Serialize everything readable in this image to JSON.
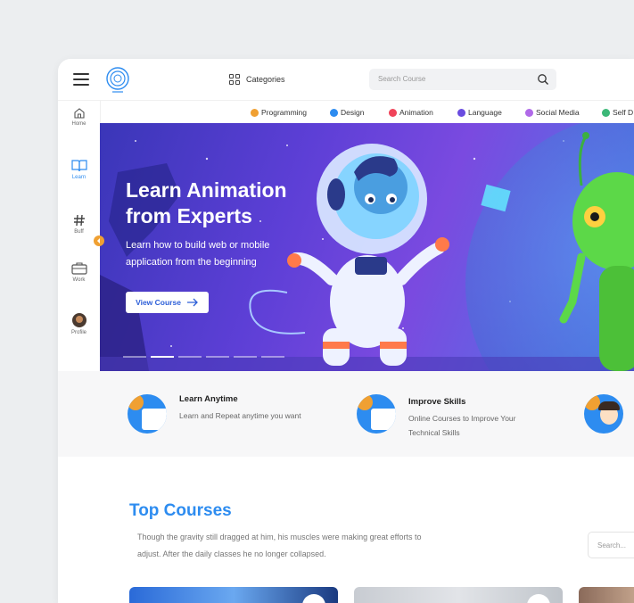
{
  "header": {
    "categories_label": "Categories",
    "search_placeholder": "Search Course"
  },
  "category_tabs": [
    {
      "label": "Programming",
      "color": "#f0a032"
    },
    {
      "label": "Design",
      "color": "#2d8cf0"
    },
    {
      "label": "Animation",
      "color": "#f0445a"
    },
    {
      "label": "Language",
      "color": "#6a4ce0"
    },
    {
      "label": "Social Media",
      "color": "#b06ae8"
    },
    {
      "label": "Self D",
      "color": "#3cb878"
    }
  ],
  "sidebar": {
    "items": [
      {
        "label": "Home",
        "icon": "home-icon"
      },
      {
        "label": "Learn",
        "icon": "book-icon",
        "active": true
      },
      {
        "label": "Buff",
        "icon": "hash-icon"
      },
      {
        "label": "Work",
        "icon": "briefcase-icon"
      },
      {
        "label": "Profile",
        "icon": "avatar"
      }
    ]
  },
  "hero": {
    "title": "Learn Animation\nfrom Experts",
    "subtitle": "Learn how to build web or mobile\napplication from the beginning",
    "button_label": "View Course",
    "slide_count": 6,
    "active_slide": 2
  },
  "features": [
    {
      "title": "Learn Anytime",
      "desc": "Learn and Repeat anytime you want"
    },
    {
      "title": "Improve Skills",
      "desc": "Online Courses to Improve Your\nTechnical Skills"
    }
  ],
  "top_courses": {
    "title": "Top Courses",
    "desc": "Though the gravity still dragged at him, his muscles were making great efforts to\nadjust. After the daily classes he no longer collapsed.",
    "search_placeholder": "Search..."
  },
  "colors": {
    "accent": "#2d8cf0",
    "orange": "#f0a032"
  }
}
